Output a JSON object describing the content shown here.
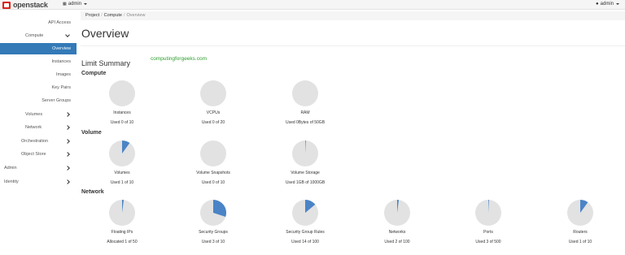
{
  "topbar": {
    "brand": "openstack",
    "project_label": "admin",
    "user_label": "admin"
  },
  "sidebar": {
    "api_access": "API Access",
    "compute": "Compute",
    "overview": "Overview",
    "instances": "Instances",
    "images": "Images",
    "key_pairs": "Key Pairs",
    "server_groups": "Server Groups",
    "volumes": "Volumes",
    "network": "Network",
    "orchestration": "Orchestration",
    "object_store": "Object Store",
    "admin": "Admin",
    "identity": "Identity"
  },
  "breadcrumb": {
    "project": "Project",
    "compute": "Compute",
    "current": "Overview"
  },
  "page": {
    "title": "Overview",
    "watermark": "computingforgeeks.com",
    "limit_summary": "Limit Summary"
  },
  "colors": {
    "accent": "#337ab7",
    "pie_bg": "#e2e2e2",
    "pie_fill": "#4a84c6"
  },
  "sections": [
    {
      "title": "Compute",
      "charts": [
        {
          "label": "Instances",
          "used_text": "Used 0 of 10",
          "fraction": 0
        },
        {
          "label": "VCPUs",
          "used_text": "Used 0 of 20",
          "fraction": 0
        },
        {
          "label": "RAM",
          "used_text": "Used 0Bytes of 50GB",
          "fraction": 0
        }
      ]
    },
    {
      "title": "Volume",
      "charts": [
        {
          "label": "Volumes",
          "used_text": "Used 1 of 10",
          "fraction": 0.1
        },
        {
          "label": "Volume Snapshots",
          "used_text": "Used 0 of 10",
          "fraction": 0
        },
        {
          "label": "Volume Storage",
          "used_text": "Used 1GB of 1000GB",
          "fraction": 0.001
        }
      ]
    },
    {
      "title": "Network",
      "charts": [
        {
          "label": "Floating IPs",
          "used_text": "Allocated 1 of 50",
          "fraction": 0.02
        },
        {
          "label": "Security Groups",
          "used_text": "Used 3 of 10",
          "fraction": 0.3
        },
        {
          "label": "Security Group Rules",
          "used_text": "Used 14 of 100",
          "fraction": 0.14
        },
        {
          "label": "Networks",
          "used_text": "Used 2 of 100",
          "fraction": 0.02
        },
        {
          "label": "Ports",
          "used_text": "Used 3 of 500",
          "fraction": 0.006
        },
        {
          "label": "Routers",
          "used_text": "Used 1 of 10",
          "fraction": 0.1
        }
      ]
    }
  ]
}
